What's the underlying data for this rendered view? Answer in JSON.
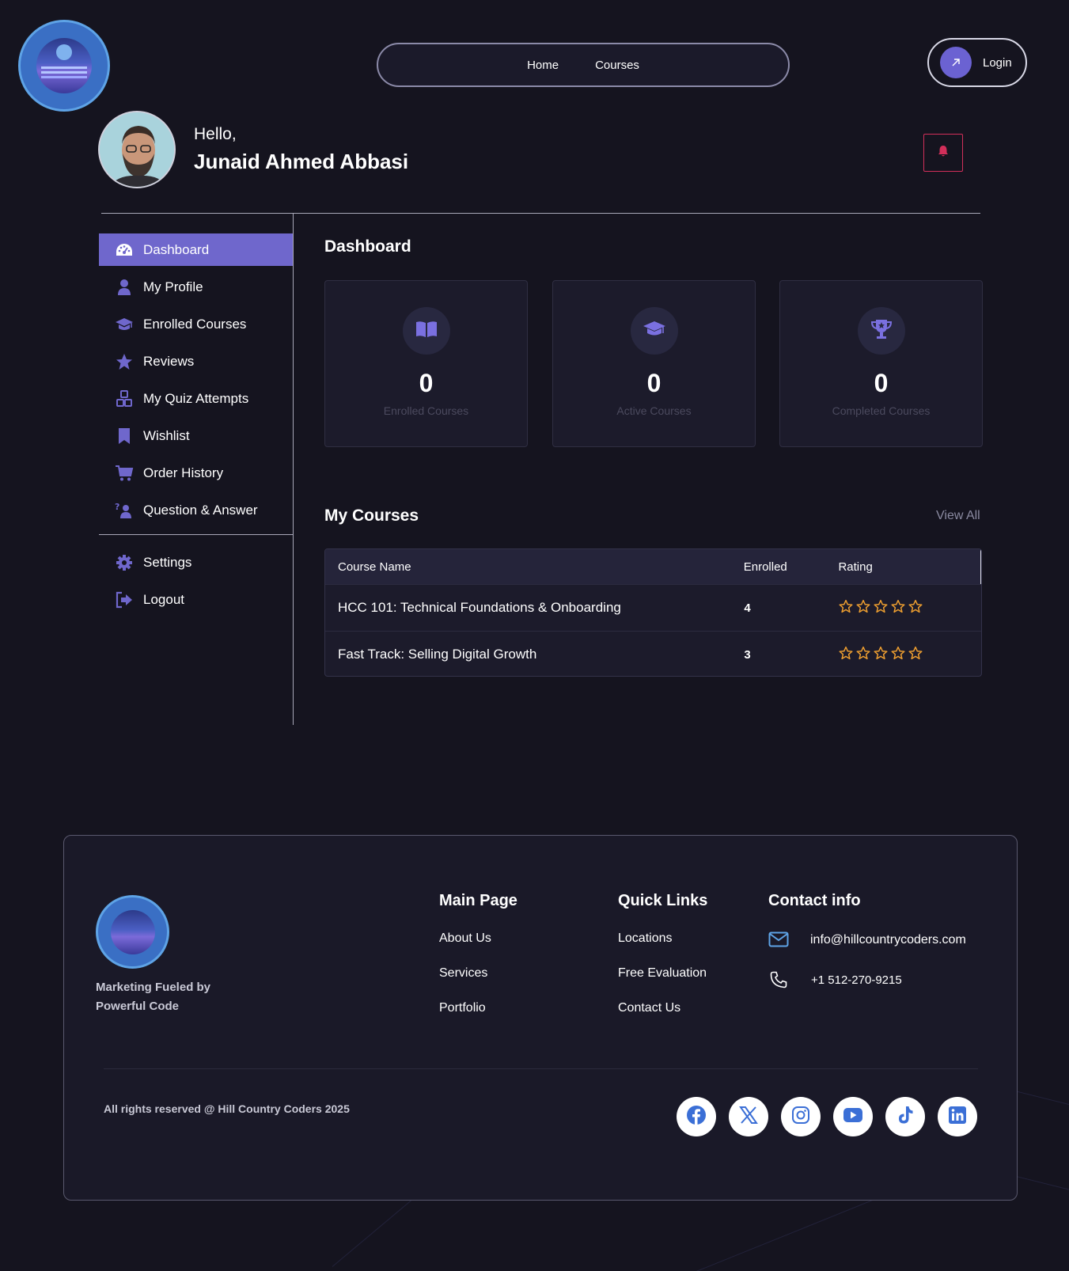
{
  "header": {
    "nav": [
      {
        "label": "Home"
      },
      {
        "label": "Courses"
      }
    ],
    "login_label": "Login"
  },
  "profile": {
    "greeting": "Hello,",
    "name": "Junaid Ahmed Abbasi"
  },
  "sidebar": {
    "items": [
      {
        "label": "Dashboard",
        "icon": "dashboard-icon",
        "active": true
      },
      {
        "label": "My Profile",
        "icon": "user-icon"
      },
      {
        "label": "Enrolled Courses",
        "icon": "graduation-cap-icon"
      },
      {
        "label": "Reviews",
        "icon": "star-icon"
      },
      {
        "label": "My Quiz Attempts",
        "icon": "cubes-icon"
      },
      {
        "label": "Wishlist",
        "icon": "bookmark-icon"
      },
      {
        "label": "Order History",
        "icon": "cart-icon"
      },
      {
        "label": "Question & Answer",
        "icon": "question-person-icon"
      }
    ],
    "bottom_items": [
      {
        "label": "Settings",
        "icon": "gear-icon"
      },
      {
        "label": "Logout",
        "icon": "logout-icon"
      }
    ]
  },
  "dashboard": {
    "title": "Dashboard",
    "stats": [
      {
        "value": "0",
        "label": "Enrolled Courses",
        "icon": "book-icon"
      },
      {
        "value": "0",
        "label": "Active Courses",
        "icon": "graduation-cap-icon"
      },
      {
        "value": "0",
        "label": "Completed Courses",
        "icon": "trophy-icon"
      }
    ]
  },
  "my_courses": {
    "title": "My Courses",
    "view_all": "View All",
    "columns": [
      "Course Name",
      "Enrolled",
      "Rating"
    ],
    "rows": [
      {
        "name": "HCC 101: Technical Foundations & Onboarding",
        "enrolled": "4",
        "rating": 0
      },
      {
        "name": "Fast Track: Selling Digital Growth",
        "enrolled": "3",
        "rating": 0
      }
    ]
  },
  "footer": {
    "tagline": "Marketing Fueled by Powerful Code",
    "main_page": {
      "title": "Main Page",
      "links": [
        "About Us",
        "Services",
        "Portfolio"
      ]
    },
    "quick_links": {
      "title": "Quick Links",
      "links": [
        "Locations",
        "Free Evaluation",
        "Contact Us"
      ]
    },
    "contact": {
      "title": "Contact info",
      "email": "info@hillcountrycoders.com",
      "phone": "+1 512-270-9215"
    },
    "copyright": "All rights reserved @ Hill Country Coders 2025",
    "social": [
      "facebook-icon",
      "x-icon",
      "instagram-icon",
      "youtube-icon",
      "tiktok-icon",
      "linkedin-icon"
    ]
  },
  "colors": {
    "accent": "#6f67cc",
    "background": "#15141f",
    "star": "#f0a030",
    "bell": "#d22f5a"
  }
}
